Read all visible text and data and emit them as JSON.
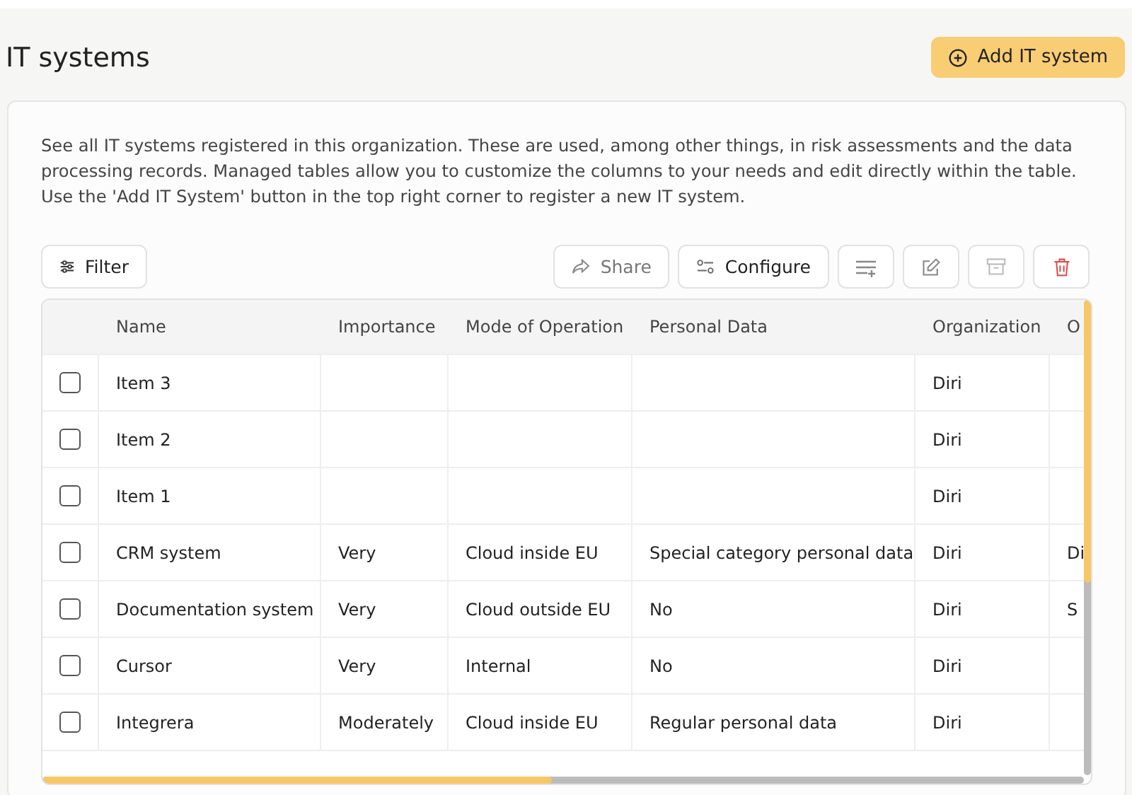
{
  "page": {
    "title": "IT systems",
    "add_button": "Add IT system"
  },
  "description": "See all IT systems registered in this organization. These are used, among other things, in risk assessments and the data processing records. Managed tables allow you to customize the columns to your needs and edit directly within the table. Use the 'Add IT System' button in the top right corner to register a new IT system.",
  "toolbar": {
    "filter": "Filter",
    "share": "Share",
    "configure": "Configure"
  },
  "table": {
    "columns": [
      "Name",
      "Importance",
      "Mode of Operation",
      "Personal Data",
      "Organization",
      "O"
    ],
    "rows": [
      {
        "checked": false,
        "cells": [
          "Item 3",
          "",
          "",
          "",
          "Diri",
          ""
        ]
      },
      {
        "checked": false,
        "cells": [
          "Item 2",
          "",
          "",
          "",
          "Diri",
          ""
        ]
      },
      {
        "checked": false,
        "cells": [
          "Item 1",
          "",
          "",
          "",
          "Diri",
          ""
        ]
      },
      {
        "checked": false,
        "cells": [
          "CRM system",
          "Very",
          "Cloud inside EU",
          "Special category personal data",
          "Diri",
          "Di"
        ]
      },
      {
        "checked": false,
        "cells": [
          "Documentation system",
          "Very",
          "Cloud outside EU",
          "No",
          "Diri",
          "S"
        ]
      },
      {
        "checked": false,
        "cells": [
          "Cursor",
          "Very",
          "Internal",
          "No",
          "Diri",
          ""
        ]
      },
      {
        "checked": false,
        "cells": [
          "Integrera",
          "Moderately",
          "Cloud inside EU",
          "Regular personal data",
          "Diri",
          ""
        ]
      }
    ]
  }
}
